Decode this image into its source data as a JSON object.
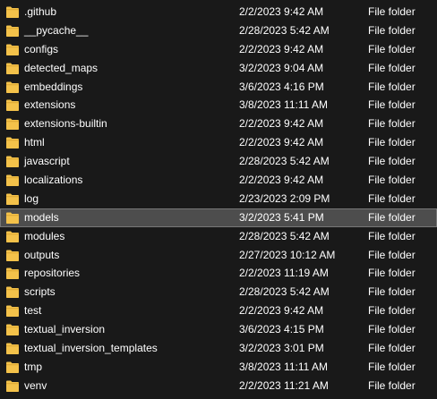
{
  "colors": {
    "background": "#191919",
    "selected_row": "#4d4d4d",
    "folder_icon": "#f3c24a",
    "text": "#ffffff"
  },
  "files": [
    {
      "name": ".github",
      "date": "2/2/2023 9:42 AM",
      "type": "File folder",
      "icon": "folder-icon"
    },
    {
      "name": "__pycache__",
      "date": "2/28/2023 5:42 AM",
      "type": "File folder",
      "icon": "folder-icon"
    },
    {
      "name": "configs",
      "date": "2/2/2023 9:42 AM",
      "type": "File folder",
      "icon": "folder-icon"
    },
    {
      "name": "detected_maps",
      "date": "3/2/2023 9:04 AM",
      "type": "File folder",
      "icon": "folder-icon"
    },
    {
      "name": "embeddings",
      "date": "3/6/2023 4:16 PM",
      "type": "File folder",
      "icon": "folder-icon"
    },
    {
      "name": "extensions",
      "date": "3/8/2023 11:11 AM",
      "type": "File folder",
      "icon": "folder-icon"
    },
    {
      "name": "extensions-builtin",
      "date": "2/2/2023 9:42 AM",
      "type": "File folder",
      "icon": "folder-icon"
    },
    {
      "name": "html",
      "date": "2/2/2023 9:42 AM",
      "type": "File folder",
      "icon": "folder-icon"
    },
    {
      "name": "javascript",
      "date": "2/28/2023 5:42 AM",
      "type": "File folder",
      "icon": "folder-icon"
    },
    {
      "name": "localizations",
      "date": "2/2/2023 9:42 AM",
      "type": "File folder",
      "icon": "folder-icon"
    },
    {
      "name": "log",
      "date": "2/23/2023 2:09 PM",
      "type": "File folder",
      "icon": "folder-icon"
    },
    {
      "name": "models",
      "date": "3/2/2023 5:41 PM",
      "type": "File folder",
      "icon": "folder-icon",
      "selected": true
    },
    {
      "name": "modules",
      "date": "2/28/2023 5:42 AM",
      "type": "File folder",
      "icon": "folder-icon"
    },
    {
      "name": "outputs",
      "date": "2/27/2023 10:12 AM",
      "type": "File folder",
      "icon": "folder-icon"
    },
    {
      "name": "repositories",
      "date": "2/2/2023 11:19 AM",
      "type": "File folder",
      "icon": "folder-icon"
    },
    {
      "name": "scripts",
      "date": "2/28/2023 5:42 AM",
      "type": "File folder",
      "icon": "folder-icon"
    },
    {
      "name": "test",
      "date": "2/2/2023 9:42 AM",
      "type": "File folder",
      "icon": "folder-icon"
    },
    {
      "name": "textual_inversion",
      "date": "3/6/2023 4:15 PM",
      "type": "File folder",
      "icon": "folder-icon"
    },
    {
      "name": "textual_inversion_templates",
      "date": "3/2/2023 3:01 PM",
      "type": "File folder",
      "icon": "folder-icon"
    },
    {
      "name": "tmp",
      "date": "3/8/2023 11:11 AM",
      "type": "File folder",
      "icon": "folder-icon"
    },
    {
      "name": "venv",
      "date": "2/2/2023 11:21 AM",
      "type": "File folder",
      "icon": "folder-icon"
    }
  ]
}
